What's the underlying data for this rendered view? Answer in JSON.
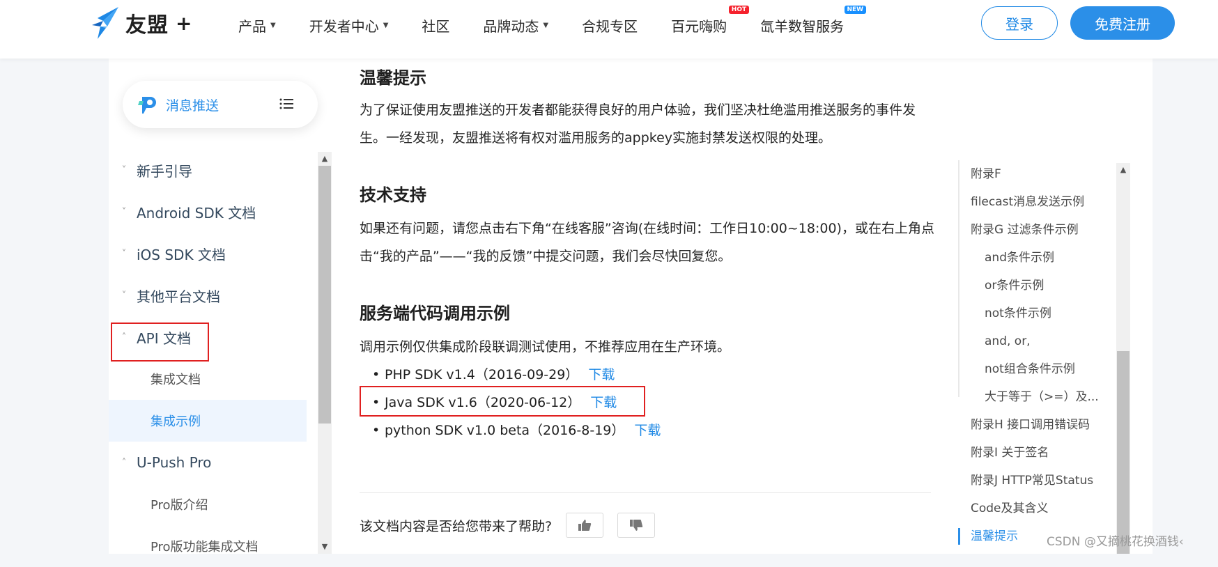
{
  "header": {
    "logo_text": "友盟",
    "logo_plus": "+",
    "nav": [
      {
        "label": "产品",
        "caret": true
      },
      {
        "label": "开发者中心",
        "caret": true
      },
      {
        "label": "社区",
        "caret": false
      },
      {
        "label": "品牌动态",
        "caret": true
      },
      {
        "label": "合规专区",
        "caret": false
      },
      {
        "label": "百元嗨购",
        "caret": false,
        "badge": "HOT"
      },
      {
        "label": "氙羊数智服务",
        "caret": false,
        "badge": "NEW"
      }
    ],
    "login_label": "登录",
    "register_label": "免费注册"
  },
  "sidebar": {
    "product_label": "消息推送",
    "items": [
      {
        "label": "新手引导",
        "chevron": "˅"
      },
      {
        "label": "Android SDK 文档",
        "chevron": "˅"
      },
      {
        "label": "iOS SDK 文档",
        "chevron": "˅"
      },
      {
        "label": "其他平台文档",
        "chevron": "˅"
      },
      {
        "label": "API 文档",
        "chevron": "˄"
      },
      {
        "label": "集成文档"
      },
      {
        "label": "集成示例"
      },
      {
        "label": "U-Push Pro",
        "chevron": "˄"
      },
      {
        "label": "Pro版介绍"
      },
      {
        "label": "Pro版功能集成文档"
      }
    ]
  },
  "content": {
    "notice_title": "温馨提示",
    "notice_text": "为了保证使用友盟推送的开发者都能获得良好的用户体验，我们坚决杜绝滥用推送服务的事件发生。一经发现，友盟推送将有权对滥用服务的appkey实施封禁发送权限的处理。",
    "support_title": "技术支持",
    "support_text": "如果还有问题，请您点击右下角“在线客服”咨询(在线时间：工作日10:00~18:00)，或在右上角点击“我的产品”——“我的反馈”中提交问题，我们会尽快回复您。",
    "server_title": "服务端代码调用示例",
    "server_text": "调用示例仅供集成阶段联调测试使用，不推荐应用在生产环境。",
    "sdks": [
      {
        "name": "PHP SDK v1.4（2016-09-29）",
        "link": "下载"
      },
      {
        "name": "Java SDK v1.6（2020-06-12）",
        "link": "下载"
      },
      {
        "name": "python SDK v1.0 beta（2016-8-19）",
        "link": "下载"
      }
    ],
    "feedback_question": "该文档内容是否给您带来了帮助?"
  },
  "toc": {
    "items": [
      {
        "label": "附录F",
        "level": 1
      },
      {
        "label": "filecast消息发送示例",
        "level": 1
      },
      {
        "label": "附录G 过滤条件示例",
        "level": 1
      },
      {
        "label": "and条件示例",
        "level": 2
      },
      {
        "label": "or条件示例",
        "level": 2
      },
      {
        "label": "not条件示例",
        "level": 2
      },
      {
        "label": "and, or,",
        "level": 2
      },
      {
        "label": "not组合条件示例",
        "level": 2
      },
      {
        "label": "大于等于（>=）及...",
        "level": 2
      },
      {
        "label": "附录H 接口调用错误码",
        "level": 1
      },
      {
        "label": "附录I 关于签名",
        "level": 1
      },
      {
        "label": "附录J HTTP常见Status",
        "level": 1
      },
      {
        "label": "Code及其含义",
        "level": 1
      },
      {
        "label": "温馨提示",
        "level": 1,
        "active": true
      }
    ]
  },
  "watermark": "CSDN @又摘桃花换酒钱‹",
  "colors": {
    "accent": "#2b8fe8",
    "highlight_box": "#e02020",
    "hot": "#f5222d",
    "new": "#1890ff"
  }
}
